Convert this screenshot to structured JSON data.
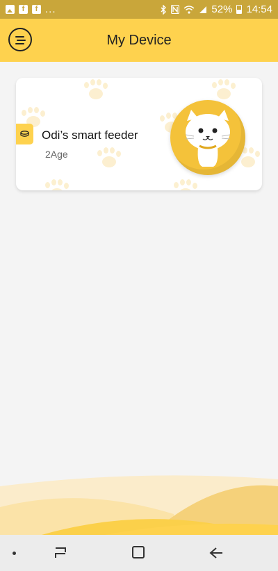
{
  "status_bar": {
    "left_more": "...",
    "battery_percent": "52%",
    "time": "14:54",
    "icons_left": [
      "gallery-icon",
      "facebook-icon",
      "facebook-icon"
    ],
    "icons_right": [
      "bluetooth-icon",
      "nfc-icon",
      "wifi-icon",
      "signal-icon",
      "battery-icon"
    ]
  },
  "header": {
    "title": "My Device",
    "menu_icon": "menu-icon"
  },
  "devices": [
    {
      "name": "Odi’s smart feeder",
      "age": "2Age",
      "type_icon": "feeder-bowl-icon",
      "avatar": "cat-avatar"
    }
  ],
  "nav_bar": {
    "buttons": [
      "recent-apps-icon",
      "home-icon",
      "back-icon"
    ]
  },
  "colors": {
    "accent": "#fed24e",
    "status_bar": "#c9a63a",
    "background": "#f4f4f4",
    "avatar": "#f4c23a"
  }
}
